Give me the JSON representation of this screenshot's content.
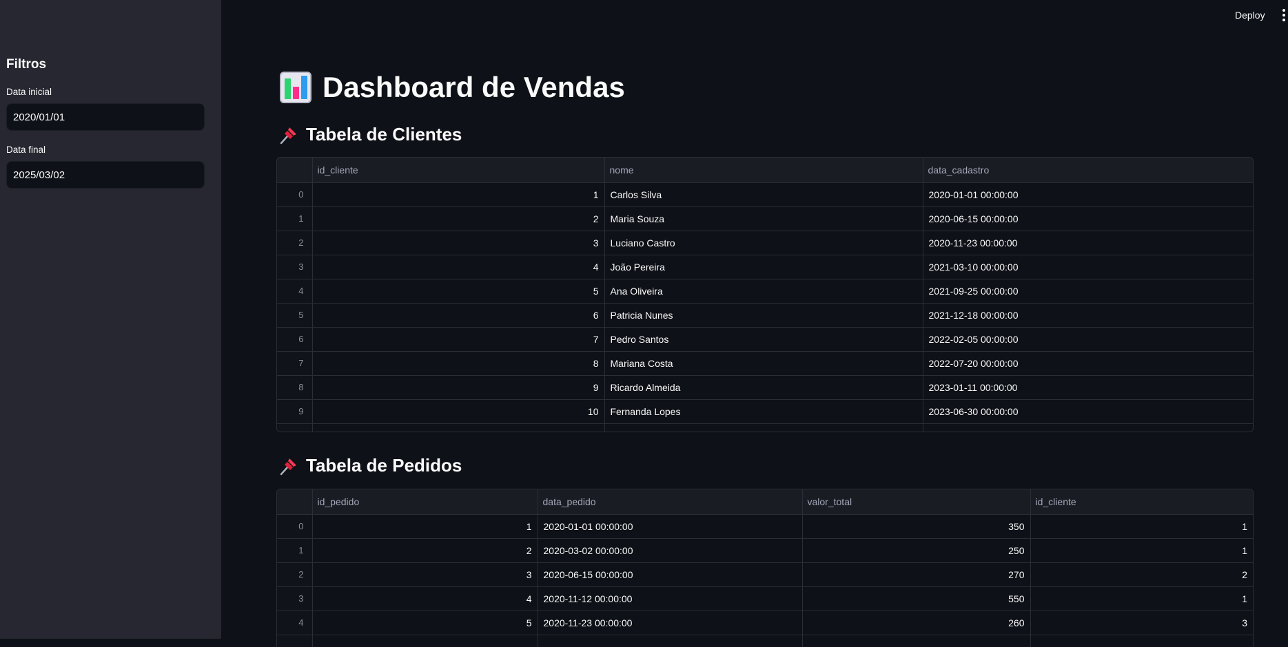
{
  "header": {
    "deploy_label": "Deploy",
    "menu_icon": "kebab-menu-icon"
  },
  "sidebar": {
    "title": "Filtros",
    "start_label": "Data inicial",
    "start_value": "2020/01/01",
    "end_label": "Data final",
    "end_value": "2025/03/02"
  },
  "main": {
    "title": "Dashboard de Vendas",
    "title_icon": "bar-chart-icon",
    "clientes_title": "Tabela de Clientes",
    "pedidos_title": "Tabela de Pedidos",
    "section_icon": "pushpin-icon"
  },
  "clientes": {
    "columns": [
      "",
      "id_cliente",
      "nome",
      "data_cadastro"
    ],
    "rows": [
      [
        "0",
        "1",
        "Carlos Silva",
        "2020-01-01 00:00:00"
      ],
      [
        "1",
        "2",
        "Maria Souza",
        "2020-06-15 00:00:00"
      ],
      [
        "2",
        "3",
        "Luciano Castro",
        "2020-11-23 00:00:00"
      ],
      [
        "3",
        "4",
        "João Pereira",
        "2021-03-10 00:00:00"
      ],
      [
        "4",
        "5",
        "Ana Oliveira",
        "2021-09-25 00:00:00"
      ],
      [
        "5",
        "6",
        "Patricia Nunes",
        "2021-12-18 00:00:00"
      ],
      [
        "6",
        "7",
        "Pedro Santos",
        "2022-02-05 00:00:00"
      ],
      [
        "7",
        "8",
        "Mariana Costa",
        "2022-07-20 00:00:00"
      ],
      [
        "8",
        "9",
        "Ricardo Almeida",
        "2023-01-11 00:00:00"
      ],
      [
        "9",
        "10",
        "Fernanda Lopes",
        "2023-06-30 00:00:00"
      ]
    ]
  },
  "pedidos": {
    "columns": [
      "",
      "id_pedido",
      "data_pedido",
      "valor_total",
      "id_cliente"
    ],
    "rows": [
      [
        "0",
        "1",
        "2020-01-01 00:00:00",
        "350",
        "1"
      ],
      [
        "1",
        "2",
        "2020-03-02 00:00:00",
        "250",
        "1"
      ],
      [
        "2",
        "3",
        "2020-06-15 00:00:00",
        "270",
        "2"
      ],
      [
        "3",
        "4",
        "2020-11-12 00:00:00",
        "550",
        "1"
      ],
      [
        "4",
        "5",
        "2020-11-23 00:00:00",
        "260",
        "3"
      ]
    ]
  }
}
